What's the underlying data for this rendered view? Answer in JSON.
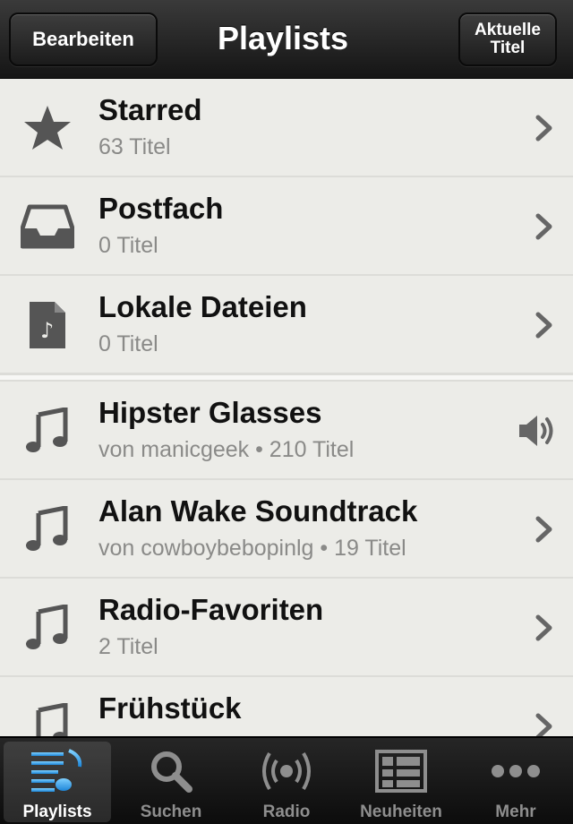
{
  "navbar": {
    "left_button": "Bearbeiten",
    "title": "Playlists",
    "right_button": "Aktuelle\nTitel"
  },
  "playlists_fixed": [
    {
      "title": "Starred",
      "subtitle": "63 Titel",
      "icon": "star-icon"
    },
    {
      "title": "Postfach",
      "subtitle": "0 Titel",
      "icon": "inbox-tray-icon"
    },
    {
      "title": "Lokale Dateien",
      "subtitle": "0 Titel",
      "icon": "music-file-icon"
    }
  ],
  "playlists_user": [
    {
      "title": "Hipster Glasses",
      "subtitle": "von manicgeek • 210 Titel",
      "icon": "music-note-icon",
      "playing": true
    },
    {
      "title": "Alan Wake Soundtrack",
      "subtitle": "von cowboybebopinlg • 19 Titel",
      "icon": "music-note-icon"
    },
    {
      "title": "Radio-Favoriten",
      "subtitle": "2 Titel",
      "icon": "music-note-icon"
    },
    {
      "title": "Frühstück",
      "subtitle": "",
      "icon": "music-note-icon"
    }
  ],
  "tabbar": {
    "tabs": [
      {
        "label": "Playlists",
        "icon": "playlists-icon",
        "active": true
      },
      {
        "label": "Suchen",
        "icon": "search-icon"
      },
      {
        "label": "Radio",
        "icon": "radio-icon"
      },
      {
        "label": "Neuheiten",
        "icon": "whats-new-icon"
      },
      {
        "label": "Mehr",
        "icon": "more-icon"
      }
    ]
  },
  "colors": {
    "navbar": "#1f1f1f",
    "list_background": "#ecece8",
    "subtitle": "#8a8a88",
    "active_tab_icon": "#3fa7f0",
    "inactive_tab": "#8e8e8e"
  }
}
